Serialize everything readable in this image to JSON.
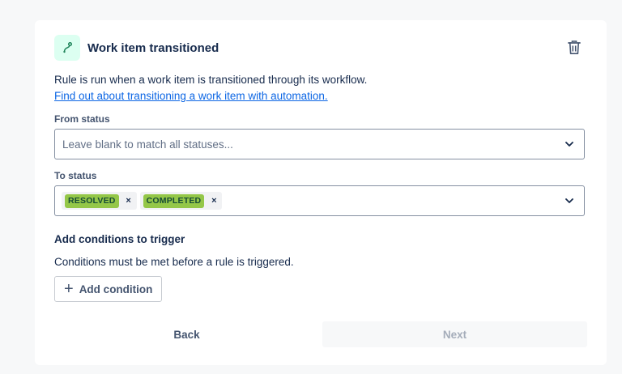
{
  "trigger": {
    "title": "Work item transitioned",
    "description": "Rule is run when a work item is transitioned through its workflow.",
    "learn_link": "Find out about transitioning a work item with automation.",
    "icon": "transition-icon",
    "icon_color": "#1f845a"
  },
  "from_status": {
    "label": "From status",
    "placeholder": "Leave blank to match all statuses..."
  },
  "to_status": {
    "label": "To status",
    "selected": [
      {
        "label": "RESOLVED",
        "remove": "×"
      },
      {
        "label": "COMPLETED",
        "remove": "×"
      }
    ],
    "lozenge_color": "#94c748"
  },
  "conditions": {
    "title": "Add conditions to trigger",
    "description": "Conditions must be met before a rule is triggered.",
    "add_label": "Add condition",
    "add_icon": "+"
  },
  "footer": {
    "back_label": "Back",
    "next_label": "Next"
  }
}
